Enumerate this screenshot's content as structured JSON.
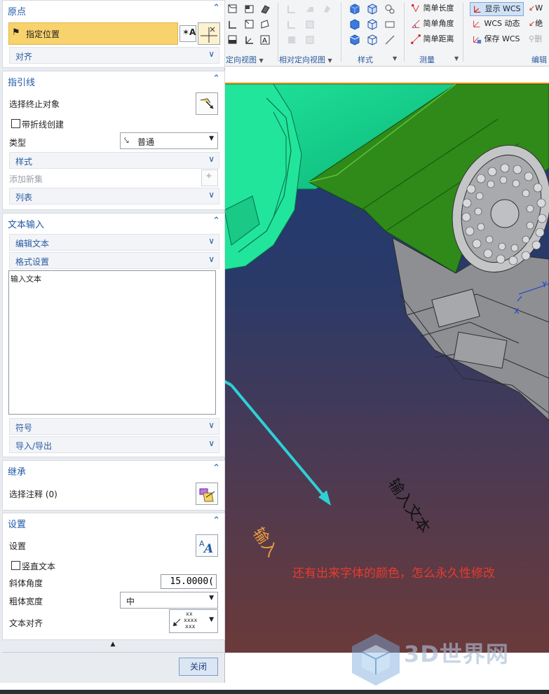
{
  "panel": {
    "origin": {
      "title": "原点",
      "specify_location": "指定位置",
      "align": "对齐"
    },
    "leader": {
      "title": "指引线",
      "select_terminating_object": "选择终止对象",
      "create_with_jog": "带折线创建",
      "type_label": "类型",
      "type_value": "普通",
      "style": "样式",
      "add_new_set": "添加新集",
      "list": "列表"
    },
    "text_input": {
      "title": "文本输入",
      "edit_text": "编辑文本",
      "formatting": "格式设置",
      "text_value": "输入文本",
      "symbols": "符号",
      "import_export": "导入/导出"
    },
    "inherit": {
      "title": "继承",
      "select_annotation": "选择注释 (0)"
    },
    "settings": {
      "title": "设置",
      "settings_label": "设置",
      "vertical_text": "竖直文本",
      "slant_angle_label": "斜体角度",
      "slant_angle_value": "15.0000(",
      "bold_width_label": "粗体宽度",
      "bold_width_value": "中",
      "text_alignment_label": "文本对齐",
      "align_glyph_top": "xx",
      "align_glyph_mid": "xxxx",
      "align_glyph_bottom": "xxx"
    },
    "close": "关闭"
  },
  "toolbar": {
    "orient_view_label": "定向视图",
    "relative_orient_view_label": "相对定向视图",
    "style_label": "样式",
    "measure_label": "测量",
    "edit_label": "编辑",
    "simple_length": "简单长度",
    "simple_angle": "简单角度",
    "simple_distance": "简单距离",
    "show_wcs": "显示 WCS",
    "wcs_dynamic": "WCS 动态",
    "save_wcs": "保存 WCS",
    "cut_w": "W",
    "cut_abs": "绝",
    "cut_del": "删"
  },
  "viewport": {
    "annotation_text": "还有出来字体的颜色，怎么永久性修改",
    "preview_text": "输入文本",
    "preview_text_orange": "输入",
    "axis_x": "X",
    "axis_y": "Y"
  },
  "watermark": {
    "text": "3D世界网"
  },
  "colors": {
    "panel_header": "#1f5aa6",
    "highlight_row": "#f8d26c",
    "annotation": "#e83a2e",
    "arrow": "#2fd0d6",
    "green_part": "#2f8a1a",
    "teal_part": "#18d890"
  }
}
